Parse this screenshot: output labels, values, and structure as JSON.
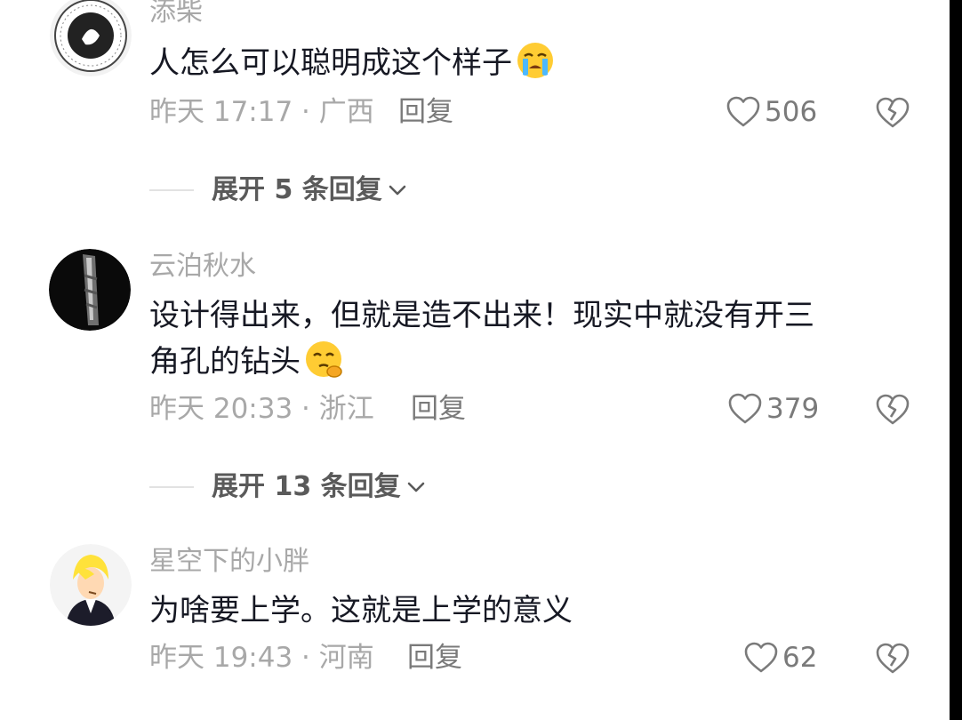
{
  "comments": [
    {
      "username": "添柴",
      "text": "人怎么可以聪明成这个样子",
      "emoji": "crying-face-emoji",
      "time_location": "昨天 17:17 · 广西",
      "reply": "回复",
      "likes": "506",
      "expand": "展开 5 条回复"
    },
    {
      "username": "云泊秋水",
      "text_line1": "设计得出来，但就是造不出来！现实中就没有开三",
      "text_line2": "角孔的钻头",
      "emoji": "thinking-face-emoji",
      "time_location": "昨天 20:33 · 浙江",
      "reply": "回复",
      "likes": "379",
      "expand": "展开 13 条回复"
    },
    {
      "username": "星空下的小胖",
      "text": "为啥要上学。这就是上学的意义",
      "time_location": "昨天 19:43 · 河南",
      "reply": "回复",
      "likes": "62"
    }
  ],
  "colors": {
    "background": "#ffffff",
    "text_primary": "#161823",
    "text_secondary": "#a8a8a8",
    "icon": "#7a7a7a"
  }
}
